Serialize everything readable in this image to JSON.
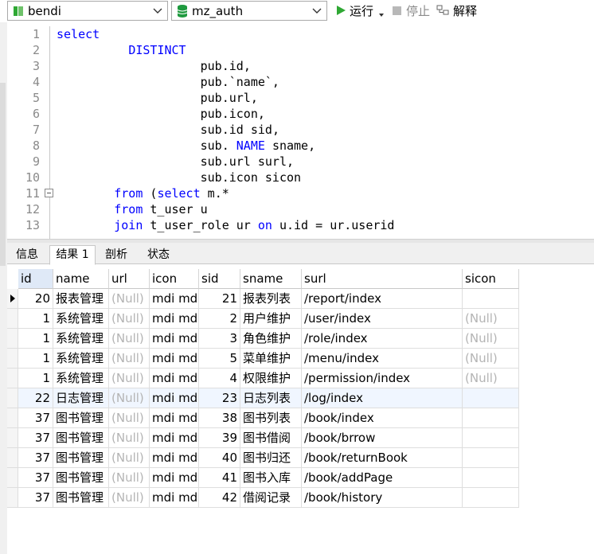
{
  "toolbar": {
    "connection": "bendi",
    "database": "mz_auth",
    "run_label": "运行",
    "stop_label": "停止",
    "explain_label": "解释"
  },
  "editor": {
    "lines": [
      {
        "n": "1",
        "text": "select"
      },
      {
        "n": "2",
        "text": "          DISTINCT"
      },
      {
        "n": "3",
        "text": "                    pub.id,"
      },
      {
        "n": "4",
        "text": "                    pub.`name`,"
      },
      {
        "n": "5",
        "text": "                    pub.url,"
      },
      {
        "n": "6",
        "text": "                    pub.icon,"
      },
      {
        "n": "7",
        "text": "                    sub.id sid,"
      },
      {
        "n": "8",
        "text": "                    sub. NAME sname,"
      },
      {
        "n": "9",
        "text": "                    sub.url surl,"
      },
      {
        "n": "10",
        "text": "                    sub.icon sicon"
      },
      {
        "n": "11",
        "text": "        from (select m.*"
      },
      {
        "n": "12",
        "text": "        from t_user u"
      },
      {
        "n": "13",
        "text": "        join t_user_role ur on u.id = ur.userid"
      }
    ]
  },
  "tabs": [
    "信息",
    "结果 1",
    "剖析",
    "状态"
  ],
  "results": {
    "columns": [
      "id",
      "name",
      "url",
      "icon",
      "sid",
      "sname",
      "surl",
      "sicon"
    ],
    "rows": [
      [
        "20",
        "报表管理",
        "(Null)",
        "mdi mdi",
        "21",
        "报表列表",
        "/report/index",
        ""
      ],
      [
        "1",
        "系统管理",
        "(Null)",
        "mdi mdi",
        "2",
        "用户维护",
        "/user/index",
        "(Null)"
      ],
      [
        "1",
        "系统管理",
        "(Null)",
        "mdi mdi",
        "3",
        "角色维护",
        "/role/index",
        "(Null)"
      ],
      [
        "1",
        "系统管理",
        "(Null)",
        "mdi mdi",
        "5",
        "菜单维护",
        "/menu/index",
        "(Null)"
      ],
      [
        "1",
        "系统管理",
        "(Null)",
        "mdi mdi",
        "4",
        "权限维护",
        "/permission/index",
        "(Null)"
      ],
      [
        "22",
        "日志管理",
        "(Null)",
        "mdi mdi",
        "23",
        "日志列表",
        "/log/index",
        ""
      ],
      [
        "37",
        "图书管理",
        "(Null)",
        "mdi mdi",
        "38",
        "图书列表",
        "/book/index",
        ""
      ],
      [
        "37",
        "图书管理",
        "(Null)",
        "mdi mdi",
        "39",
        "图书借阅",
        "/book/brrow",
        ""
      ],
      [
        "37",
        "图书管理",
        "(Null)",
        "mdi mdi",
        "40",
        "图书归还",
        "/book/returnBook",
        ""
      ],
      [
        "37",
        "图书管理",
        "(Null)",
        "mdi mdi",
        "41",
        "图书入库",
        "/book/addPage",
        ""
      ],
      [
        "37",
        "图书管理",
        "(Null)",
        "mdi mdi",
        "42",
        "借阅记录",
        "/book/history",
        ""
      ]
    ]
  },
  "icons": {
    "connection": "connection-icon",
    "database": "database-icon",
    "run": "play-icon",
    "stop": "stop-icon",
    "explain": "explain-icon"
  },
  "colors": {
    "keyword": "#0000ff",
    "null_text": "#b4b4b4",
    "run_green": "#2fa834",
    "db_green": "#1f9a3f"
  }
}
